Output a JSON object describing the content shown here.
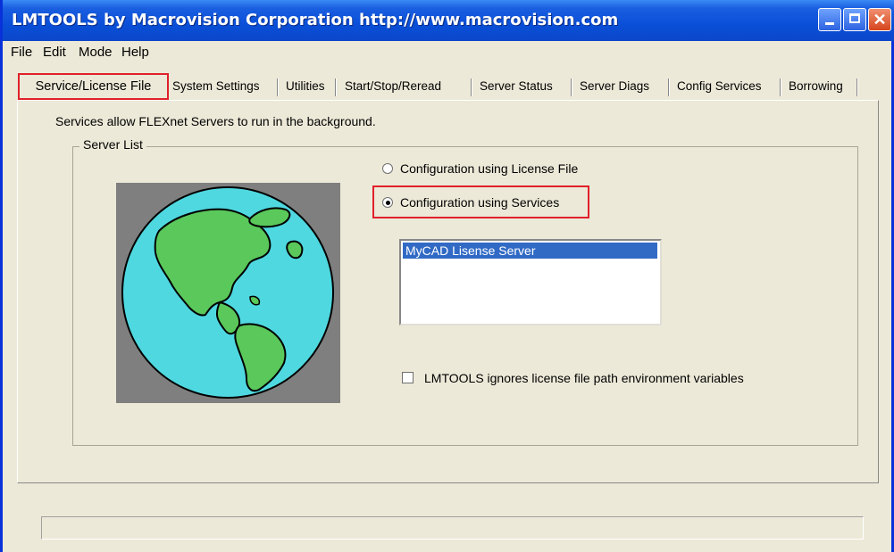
{
  "window": {
    "title": "LMTOOLS by Macrovision Corporation http://www.macrovision.com",
    "close_glyph": "✕"
  },
  "menu": [
    "File",
    "Edit",
    "Mode",
    "Help"
  ],
  "tabs": [
    "Service/License File",
    "System Settings",
    "Utilities",
    "Start/Stop/Reread",
    "Server Status",
    "Server Diags",
    "Config Services",
    "Borrowing"
  ],
  "active_tab": "Service/License File",
  "panel": {
    "description": "Services allow FLEXnet Servers to run in the background.",
    "group_label": "Server List",
    "radio_license_file": "Configuration using License File",
    "radio_services": "Configuration using Services",
    "selected_radio": "services",
    "services_list": [
      "MyCAD Lisense Server"
    ],
    "checkbox_label": "LMTOOLS ignores license file path environment variables",
    "checkbox_checked": false
  },
  "status_text": "",
  "colors": {
    "highlight_red": "#e0202a",
    "title_blue": "#0a4fd8",
    "globe_ocean": "#4fd8e0",
    "globe_land": "#5ac85a"
  }
}
